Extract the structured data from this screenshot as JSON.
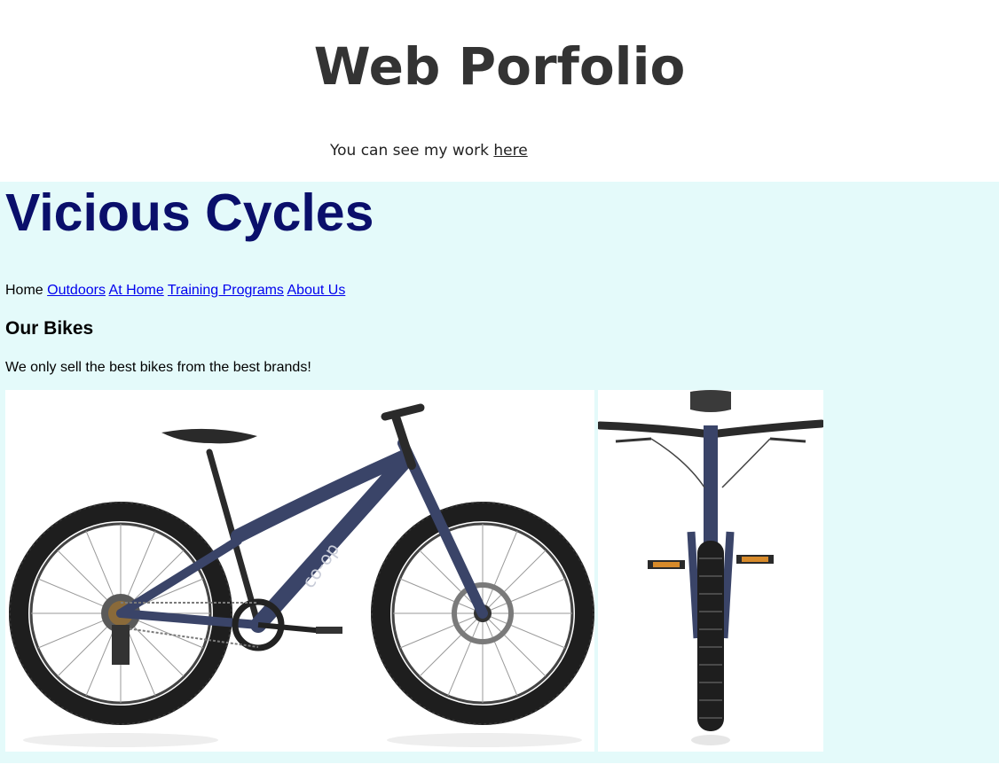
{
  "portfolio": {
    "title": "Web Porfolio",
    "intro_text": "You can see my work ",
    "intro_link": "here"
  },
  "site": {
    "title": "Vicious Cycles",
    "nav": {
      "current": "Home",
      "links": [
        "Outdoors",
        "At Home",
        "Training Programs",
        "About Us"
      ]
    },
    "section_title": "Our Bikes",
    "section_text": "We only sell the best bikes from the best brands!",
    "images": [
      {
        "name": "bike-side-view",
        "brand_text": "co-op"
      },
      {
        "name": "bike-front-view"
      }
    ]
  },
  "colors": {
    "frame_bg": "#e4fafa",
    "site_title": "#0a0f6b",
    "link": "#0000ee",
    "portfolio_title": "#333333",
    "bike_frame": "#3a4468",
    "tire": "#222222"
  }
}
